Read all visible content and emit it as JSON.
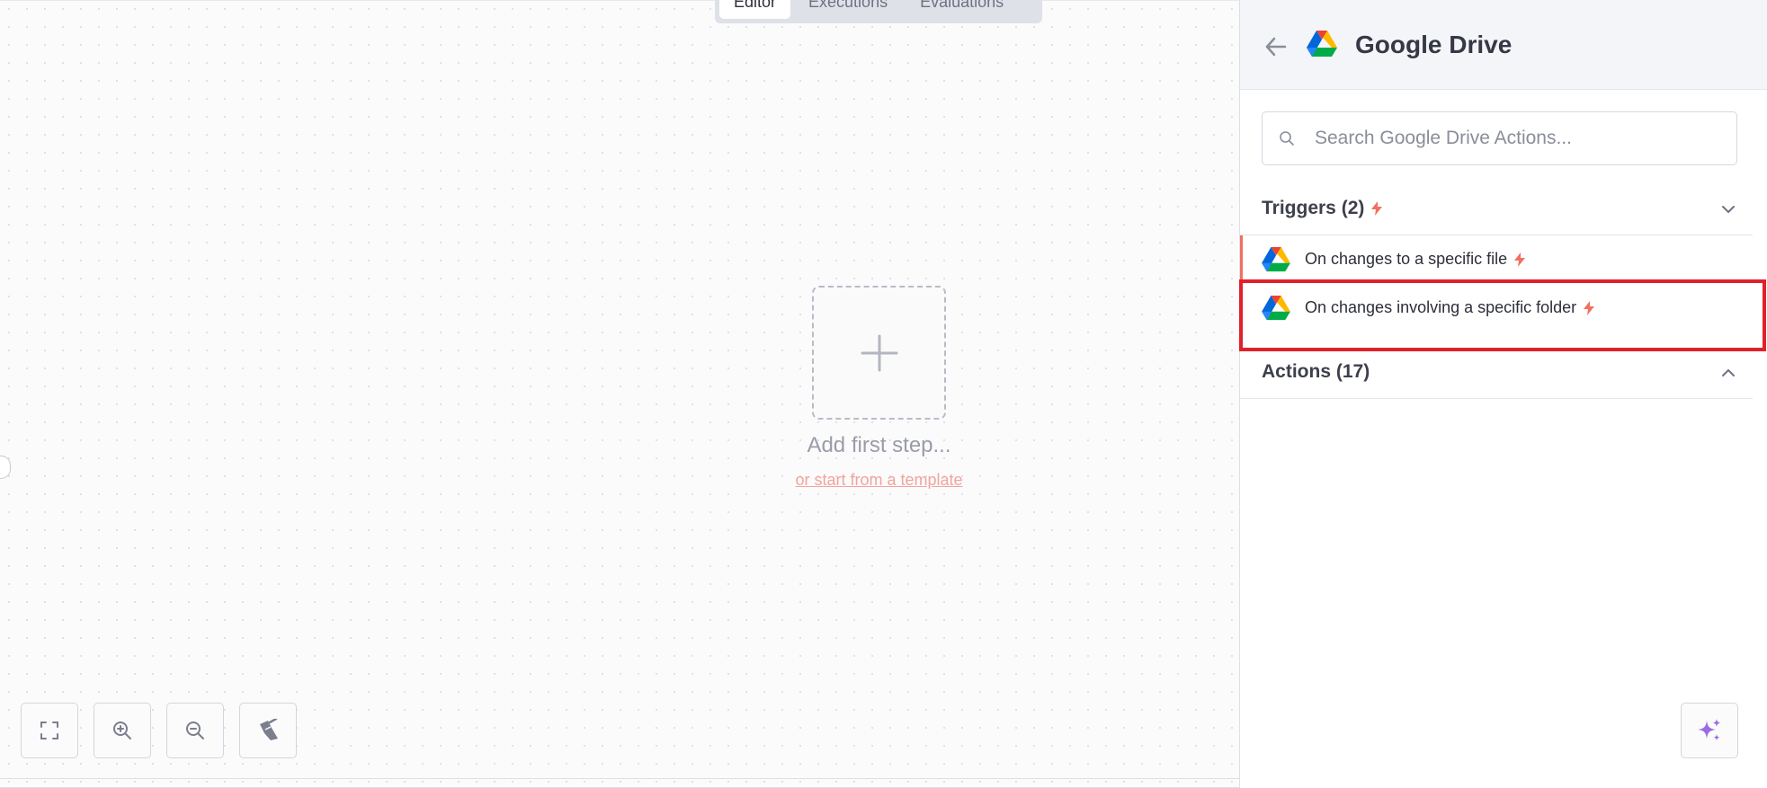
{
  "tabs": [
    {
      "label": "Editor",
      "active": true
    },
    {
      "label": "Executions",
      "active": false
    },
    {
      "label": "Evaluations",
      "active": false
    }
  ],
  "canvas": {
    "add_step_title": "Add first step...",
    "template_link": "or start from a template"
  },
  "controls": {
    "icons": [
      "fit-view-icon",
      "zoom-in-icon",
      "zoom-out-icon",
      "tidy-up-icon"
    ]
  },
  "panel": {
    "title": "Google Drive",
    "search": {
      "placeholder": "Search Google Drive Actions...",
      "value": ""
    },
    "triggers": {
      "title": "Triggers (2)",
      "items": [
        {
          "label": "On changes to a specific file"
        },
        {
          "label": "On changes involving a specific folder"
        }
      ]
    },
    "actions": {
      "title": "Actions (17)"
    }
  },
  "colors": {
    "accent": "#f0705d",
    "highlight": "#e0212a",
    "ai": "#9b6de3"
  }
}
